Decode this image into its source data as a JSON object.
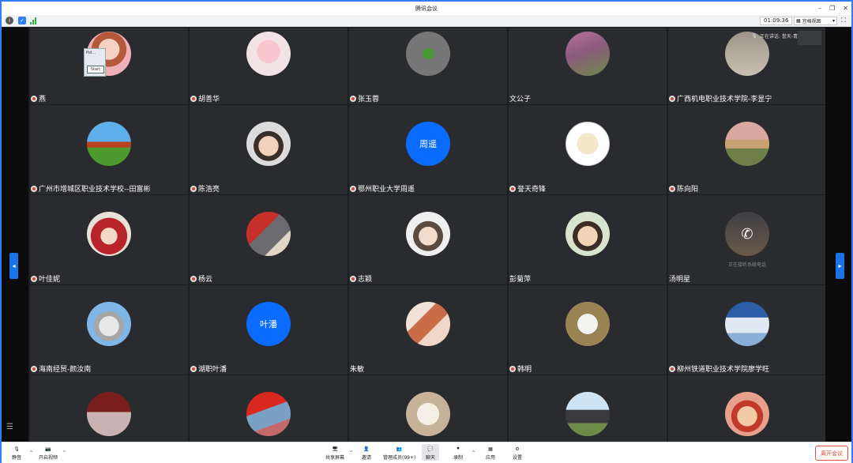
{
  "window": {
    "title": "腾讯会议"
  },
  "infobar": {
    "timer": "01:09:36",
    "view_label": "宫格视图"
  },
  "speaking": {
    "label": "正在讲话: 誉天-青老师;"
  },
  "popup": {
    "title": "Pol...",
    "button": "Start"
  },
  "participants": [
    {
      "name": "燕",
      "muted": true
    },
    {
      "name": "胡善华",
      "muted": true
    },
    {
      "name": "张玉蓉",
      "muted": true
    },
    {
      "name": "文公子",
      "muted": false
    },
    {
      "name": "广西机电职业技术学院-李昰宁",
      "muted": true
    },
    {
      "name": "广州市增城区职业技术学校--田富彬",
      "muted": true
    },
    {
      "name": "陈浩亮",
      "muted": true
    },
    {
      "name": "鄂州职业大学周遥",
      "muted": true,
      "initials": "周遥"
    },
    {
      "name": "誉天奇锋",
      "muted": true
    },
    {
      "name": "陈向阳",
      "muted": true
    },
    {
      "name": "叶佳妮",
      "muted": true
    },
    {
      "name": "杨云",
      "muted": true
    },
    {
      "name": "志颖",
      "muted": true
    },
    {
      "name": "彭菊萍",
      "muted": false
    },
    {
      "name": "汤明星",
      "muted": false,
      "subtext": "正在接听系统电话"
    },
    {
      "name": "海南经贸-颜汝南",
      "muted": true
    },
    {
      "name": "湖职叶潘",
      "muted": true,
      "initials": "叶潘"
    },
    {
      "name": "朱敏",
      "muted": false
    },
    {
      "name": "韩明",
      "muted": true
    },
    {
      "name": "柳州铁道职业技术学院廖学旺",
      "muted": true
    },
    {
      "name": "",
      "muted": false
    },
    {
      "name": "",
      "muted": false
    },
    {
      "name": "",
      "muted": false
    },
    {
      "name": "",
      "muted": false
    },
    {
      "name": "",
      "muted": false
    }
  ],
  "toolbar": {
    "mute": "静音",
    "video": "开启视频",
    "share": "共享屏幕",
    "invite": "邀请",
    "members": "管理成员(99+)",
    "chat": "聊天",
    "record": "录制",
    "apps": "应用",
    "settings": "设置",
    "leave": "离开会议"
  },
  "colors": {
    "accent": "#2f7dfa",
    "leave": "#e64a3b",
    "initials_bg": "#0a6cff"
  }
}
